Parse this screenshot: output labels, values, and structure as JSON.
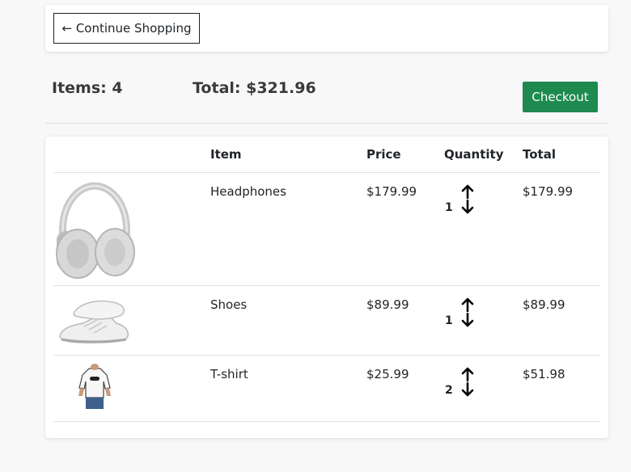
{
  "nav": {
    "continue_label": "← Continue Shopping"
  },
  "summary": {
    "items_label": "Items: 4",
    "total_label": "Total: $321.96",
    "checkout_label": "Checkout"
  },
  "colors": {
    "checkout_bg": "#1e8a4f",
    "page_bg": "#f8f8f8"
  },
  "table": {
    "headers": {
      "image": "",
      "item": "Item",
      "price": "Price",
      "quantity": "Quantity",
      "total": "Total"
    },
    "rows": [
      {
        "image_icon": "headphones-icon",
        "name": "Headphones",
        "price": "$179.99",
        "quantity": "1",
        "total": "$179.99"
      },
      {
        "image_icon": "shoes-icon",
        "name": "Shoes",
        "price": "$89.99",
        "quantity": "1",
        "total": "$89.99"
      },
      {
        "image_icon": "tshirt-icon",
        "name": "T-shirt",
        "price": "$25.99",
        "quantity": "2",
        "total": "$51.98"
      }
    ]
  }
}
